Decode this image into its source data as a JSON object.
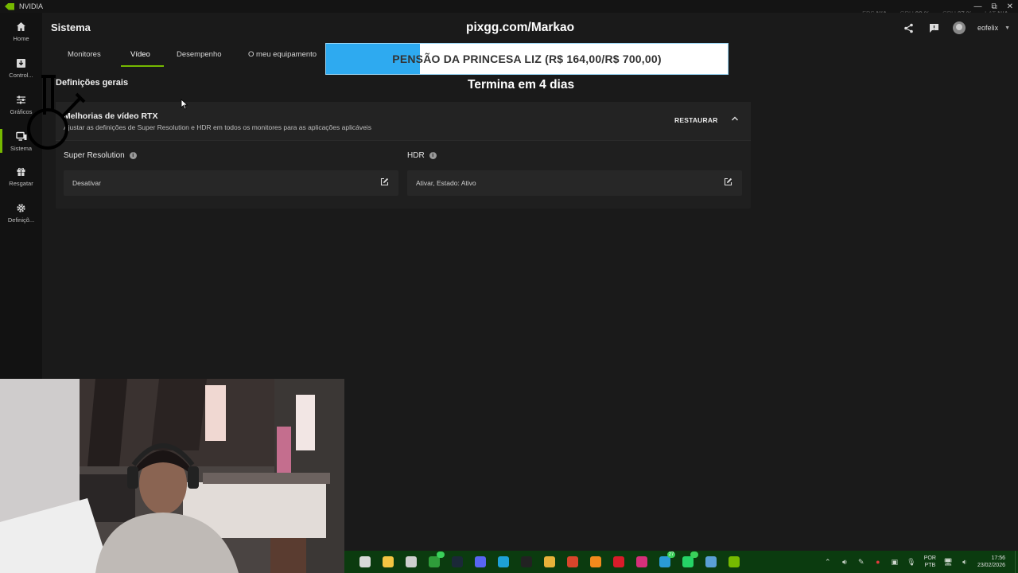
{
  "window": {
    "title": "NVIDIA",
    "controls": {
      "minimize": "—",
      "maximize": "⧉",
      "close": "✕"
    }
  },
  "perf_overlay": [
    {
      "label": "FPS",
      "value": "N/A"
    },
    {
      "label": "GPU",
      "value": "99 %"
    },
    {
      "label": "CPU",
      "value": "27 %"
    },
    {
      "label": "LAT",
      "value": "N/A"
    }
  ],
  "sidebar": {
    "items": [
      {
        "label": "Home",
        "icon": "home-icon"
      },
      {
        "label": "Control...",
        "icon": "download-icon"
      },
      {
        "label": "Gráficos",
        "icon": "sliders-icon"
      },
      {
        "label": "Sistema",
        "icon": "monitor-icon",
        "active": true
      },
      {
        "label": "Resgatar",
        "icon": "gift-icon"
      },
      {
        "label": "Definiçõ...",
        "icon": "gear-icon"
      }
    ]
  },
  "header": {
    "title": "Sistema",
    "username": "eofelix",
    "icons": [
      "share-icon",
      "feedback-icon",
      "avatar"
    ]
  },
  "tabs": [
    {
      "label": "Monitores"
    },
    {
      "label": "Vídeo",
      "active": true
    },
    {
      "label": "Desempenho"
    },
    {
      "label": "O meu equipamento"
    }
  ],
  "main": {
    "section_heading": "Definições gerais",
    "panel": {
      "title": "Melhorias de vídeo RTX",
      "subtitle": "Ajustar as definições de Super Resolution e HDR em todos os monitores para as aplicações aplicáveis",
      "restore_label": "RESTAURAR",
      "settings": [
        {
          "label": "Super Resolution",
          "value": "Desativar"
        },
        {
          "label": "HDR",
          "value": "Ativar, Estado: Ativo"
        }
      ]
    }
  },
  "overlay": {
    "url": "pixgg.com/Markao",
    "goal_text": "PENSÃO DA PRINCESA LIZ (R$ 164,00/R$ 700,00)",
    "goal_progress": 0.234,
    "goal_colors": {
      "fill": "#2eaaf0",
      "track": "#ffffff"
    },
    "timer": "Termina em 4 dias"
  },
  "taskbar": {
    "icons": [
      {
        "name": "app-icon-1",
        "color": "#d9d9d9"
      },
      {
        "name": "file-explorer-icon",
        "color": "#f4c542"
      },
      {
        "name": "microsoft-store-icon",
        "color": "#cfcfcf"
      },
      {
        "name": "xbox-icon",
        "color": "#2f9d3a",
        "badge": ""
      },
      {
        "name": "steam-icon",
        "color": "#1b2838"
      },
      {
        "name": "discord-icon",
        "color": "#5865f2"
      },
      {
        "name": "edge-icon",
        "color": "#1ea0d8"
      },
      {
        "name": "github-icon",
        "color": "#222222"
      },
      {
        "name": "chrome-icon",
        "color": "#e8b13a"
      },
      {
        "name": "red-app-icon",
        "color": "#d9452b"
      },
      {
        "name": "cloud-app-icon",
        "color": "#f28a1c"
      },
      {
        "name": "opera-icon",
        "color": "#d91c2a"
      },
      {
        "name": "instagram-icon",
        "color": "#d6307a"
      },
      {
        "name": "messenger-icon",
        "color": "#2a9bd6",
        "badge": "27"
      },
      {
        "name": "whatsapp-icon",
        "color": "#25d366",
        "badge": ""
      },
      {
        "name": "notepad-icon",
        "color": "#5aa0d6"
      },
      {
        "name": "nvidia-app-icon",
        "color": "#76b900"
      }
    ],
    "tray": {
      "language": "POR",
      "layout": "PTB",
      "time": "17:56",
      "date": "23/02/2026"
    }
  }
}
